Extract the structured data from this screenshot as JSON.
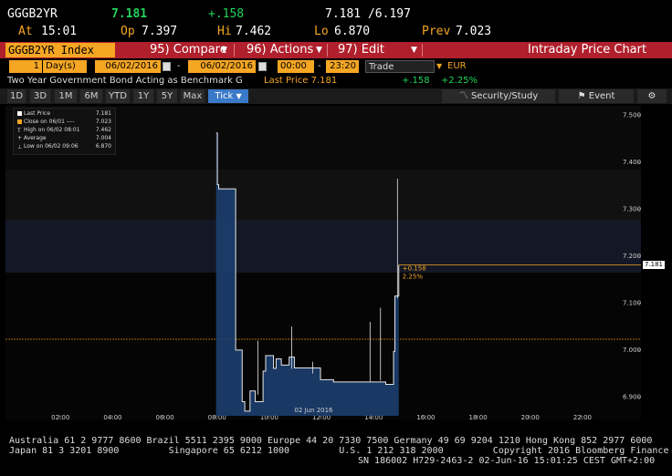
{
  "header": {
    "ticker": "GGGB2YR",
    "last": "7.181",
    "change": "+.158",
    "bid_ask": "7.181 /6.197",
    "at_label": "At",
    "at_time": "15:01",
    "op_label": "Op",
    "op_value": "7.397",
    "hi_label": "Hi",
    "hi_value": "7.462",
    "lo_label": "Lo",
    "lo_value": "6.870",
    "prev_label": "Prev",
    "prev_value": "7.023"
  },
  "command_bar": {
    "security": "GGGB2YR Index",
    "compare": "95) Compare",
    "actions": "96) Actions",
    "edit": "97) Edit",
    "title": "Intraday Price Chart"
  },
  "date_bar": {
    "interval": "1",
    "interval_unit": "Day(s)",
    "start_date": "06/02/2016",
    "end_date": "06/02/2016",
    "start_time": "00:00",
    "end_time": "23:20",
    "field": "Trade",
    "currency": "EUR"
  },
  "desc_line": {
    "description": "Two Year Government Bond Acting as Benchmark G",
    "last_price": "Last Price 7.181",
    "change": "+.158",
    "pct_change": "+2.25%"
  },
  "period_bar": {
    "periods": [
      "1D",
      "3D",
      "1M",
      "6M",
      "YTD",
      "1Y",
      "5Y",
      "Max"
    ],
    "tick_label": "Tick",
    "security_study": "Security/Study",
    "event": "Event"
  },
  "legend": {
    "rows": [
      {
        "label": "Last Price",
        "value": "7.181"
      },
      {
        "label": "Close on 06/01 ----",
        "value": "7.023"
      },
      {
        "label": "High on 06/02 08:01",
        "value": "7.462"
      },
      {
        "label": "+ Average",
        "value": "7.004"
      },
      {
        "label": "Low on 06/02 09:06",
        "value": "6.870"
      }
    ]
  },
  "chart_data": {
    "type": "area",
    "ylim": [
      6.86,
      7.52
    ],
    "yticks": [
      "7.500",
      "7.400",
      "7.300",
      "7.200",
      "7.100",
      "7.000",
      "6.900"
    ],
    "xlim": [
      0,
      24
    ],
    "xticks": [
      "02:00",
      "04:00",
      "06:00",
      "08:00",
      "10:00",
      "12:00",
      "14:00",
      "16:00",
      "18:00",
      "20:00",
      "22:00"
    ],
    "date_label": "02 Jun 2016",
    "last_value": 7.181,
    "last_tag": "7.181",
    "prev_close": 7.023,
    "annotation_change": "+0.158",
    "annotation_pct": "2.25%",
    "x": [
      8.0,
      8.05,
      8.1,
      8.15,
      8.7,
      8.75,
      9.0,
      9.1,
      9.3,
      9.5,
      9.8,
      9.9,
      10.0,
      10.2,
      10.3,
      10.5,
      10.8,
      11.0,
      11.5,
      12.0,
      12.2,
      12.5,
      13.0,
      13.5,
      14.0,
      14.5,
      14.8,
      14.85,
      14.9,
      15.0
    ],
    "y": [
      7.462,
      7.352,
      7.343,
      7.343,
      7.343,
      7.0,
      6.89,
      6.87,
      6.913,
      6.89,
      6.955,
      6.988,
      6.988,
      6.961,
      6.981,
      6.968,
      6.985,
      6.962,
      6.962,
      6.937,
      6.937,
      6.932,
      6.932,
      6.932,
      6.932,
      6.927,
      6.997,
      7.115,
      7.115,
      7.181
    ]
  },
  "footer": {
    "line1": "Australia 61 2 9777 8600 Brazil 5511 2395 9000 Europe 44 20 7330 7500 Germany 49 69 9204 1210 Hong Kong 852 2977 6000",
    "line2": "Japan 81 3 3201 8900         Singapore 65 6212 1000         U.S. 1 212 318 2000         Copyright 2016 Bloomberg Finance L.P.",
    "line3": "SN 186002 H729-2463-2 02-Jun-16 15:01:25 CEST GMT+2:00"
  }
}
